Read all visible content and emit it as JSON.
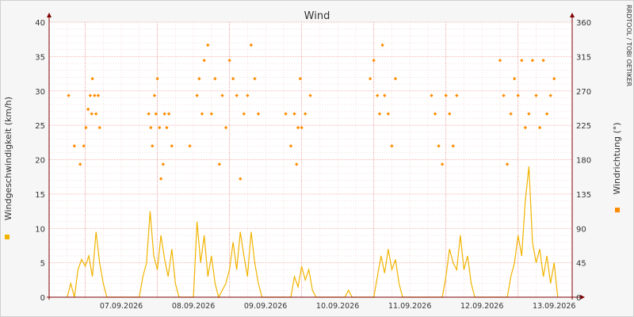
{
  "chart_data": {
    "type": "line",
    "title": "Wind",
    "watermark": "RRDTOOL / TOBI OETIKER",
    "x_dates": [
      "07.09.2026",
      "08.09.2026",
      "09.09.2026",
      "10.09.2026",
      "11.09.2026",
      "12.09.2026",
      "13.09.2026"
    ],
    "left_axis": {
      "label": "Windgeschwindigkeit (km/h)",
      "ticks": [
        0,
        5,
        10,
        15,
        20,
        25,
        30,
        35,
        40
      ],
      "ylim": [
        0,
        40
      ]
    },
    "right_axis": {
      "label": "Windrichtung (°)",
      "ticks": [
        0,
        45,
        90,
        135,
        180,
        225,
        270,
        315,
        360
      ],
      "ylim": [
        0,
        360
      ]
    },
    "colors": {
      "speed": "#f0b400",
      "direction": "#ff8c00",
      "grid_major": "#f0a0a0",
      "grid_minor": "#f2cccc",
      "axis": "#800000"
    },
    "series": [
      {
        "name": "Windgeschwindigkeit",
        "kind": "line",
        "axis": "left",
        "points": [
          [
            6.75,
            0
          ],
          [
            6.8,
            2
          ],
          [
            6.85,
            0
          ],
          [
            6.9,
            4
          ],
          [
            6.95,
            5.5
          ],
          [
            7.0,
            4.5
          ],
          [
            7.05,
            6
          ],
          [
            7.1,
            3
          ],
          [
            7.15,
            9.5
          ],
          [
            7.2,
            5
          ],
          [
            7.25,
            2
          ],
          [
            7.3,
            0
          ],
          [
            7.75,
            0
          ],
          [
            7.8,
            3
          ],
          [
            7.85,
            5
          ],
          [
            7.9,
            12.5
          ],
          [
            7.95,
            6
          ],
          [
            8.0,
            4
          ],
          [
            8.05,
            9
          ],
          [
            8.1,
            5.5
          ],
          [
            8.15,
            3
          ],
          [
            8.2,
            7
          ],
          [
            8.25,
            2
          ],
          [
            8.3,
            0
          ],
          [
            8.5,
            0
          ],
          [
            8.55,
            11
          ],
          [
            8.6,
            5
          ],
          [
            8.65,
            9
          ],
          [
            8.7,
            3
          ],
          [
            8.75,
            6
          ],
          [
            8.8,
            2
          ],
          [
            8.85,
            0
          ],
          [
            8.95,
            2
          ],
          [
            9.0,
            4
          ],
          [
            9.05,
            8
          ],
          [
            9.1,
            4
          ],
          [
            9.15,
            9.5
          ],
          [
            9.2,
            6
          ],
          [
            9.25,
            3
          ],
          [
            9.3,
            9.5
          ],
          [
            9.35,
            5
          ],
          [
            9.4,
            2
          ],
          [
            9.45,
            0
          ],
          [
            9.85,
            0
          ],
          [
            9.9,
            3
          ],
          [
            9.95,
            1.5
          ],
          [
            10.0,
            4.5
          ],
          [
            10.05,
            2.5
          ],
          [
            10.1,
            4
          ],
          [
            10.15,
            1
          ],
          [
            10.2,
            0
          ],
          [
            10.6,
            0
          ],
          [
            10.65,
            1
          ],
          [
            10.7,
            0
          ],
          [
            11.0,
            0
          ],
          [
            11.05,
            3
          ],
          [
            11.1,
            6
          ],
          [
            11.15,
            3.5
          ],
          [
            11.2,
            7
          ],
          [
            11.25,
            4
          ],
          [
            11.3,
            5.5
          ],
          [
            11.35,
            2
          ],
          [
            11.4,
            0
          ],
          [
            11.95,
            0
          ],
          [
            12.0,
            3
          ],
          [
            12.05,
            7
          ],
          [
            12.1,
            5
          ],
          [
            12.15,
            4
          ],
          [
            12.2,
            9
          ],
          [
            12.25,
            4
          ],
          [
            12.3,
            6
          ],
          [
            12.35,
            2
          ],
          [
            12.4,
            0
          ],
          [
            12.85,
            0
          ],
          [
            12.9,
            3
          ],
          [
            12.95,
            5
          ],
          [
            13.0,
            9
          ],
          [
            13.05,
            6
          ],
          [
            13.1,
            14
          ],
          [
            13.15,
            19
          ],
          [
            13.2,
            8
          ],
          [
            13.25,
            5
          ],
          [
            13.3,
            7
          ],
          [
            13.35,
            3
          ],
          [
            13.4,
            6
          ],
          [
            13.45,
            2
          ],
          [
            13.5,
            5
          ],
          [
            13.55,
            0
          ]
        ]
      },
      {
        "name": "Windrichtung",
        "kind": "points",
        "axis": "right",
        "points": [
          [
            6.77,
            264
          ],
          [
            6.85,
            198
          ],
          [
            6.93,
            174
          ],
          [
            6.98,
            198
          ],
          [
            7.01,
            222
          ],
          [
            7.04,
            246
          ],
          [
            7.07,
            264
          ],
          [
            7.09,
            240
          ],
          [
            7.1,
            286
          ],
          [
            7.13,
            264
          ],
          [
            7.15,
            240
          ],
          [
            7.18,
            264
          ],
          [
            7.2,
            222
          ],
          [
            7.88,
            240
          ],
          [
            7.91,
            222
          ],
          [
            7.93,
            198
          ],
          [
            7.96,
            264
          ],
          [
            7.98,
            240
          ],
          [
            8.0,
            286
          ],
          [
            8.03,
            222
          ],
          [
            8.05,
            155
          ],
          [
            8.08,
            174
          ],
          [
            8.1,
            240
          ],
          [
            8.13,
            222
          ],
          [
            8.16,
            240
          ],
          [
            8.2,
            198
          ],
          [
            8.45,
            198
          ],
          [
            8.55,
            264
          ],
          [
            8.58,
            286
          ],
          [
            8.62,
            240
          ],
          [
            8.65,
            310
          ],
          [
            8.7,
            330
          ],
          [
            8.75,
            240
          ],
          [
            8.8,
            286
          ],
          [
            8.86,
            174
          ],
          [
            8.9,
            264
          ],
          [
            8.95,
            222
          ],
          [
            9.0,
            310
          ],
          [
            9.05,
            286
          ],
          [
            9.1,
            264
          ],
          [
            9.15,
            155
          ],
          [
            9.2,
            240
          ],
          [
            9.25,
            264
          ],
          [
            9.3,
            330
          ],
          [
            9.35,
            286
          ],
          [
            9.4,
            240
          ],
          [
            9.78,
            240
          ],
          [
            9.85,
            198
          ],
          [
            9.9,
            240
          ],
          [
            9.93,
            174
          ],
          [
            9.95,
            222
          ],
          [
            9.98,
            286
          ],
          [
            10.0,
            222
          ],
          [
            10.05,
            240
          ],
          [
            10.12,
            264
          ],
          [
            10.95,
            286
          ],
          [
            11.0,
            310
          ],
          [
            11.05,
            264
          ],
          [
            11.08,
            240
          ],
          [
            11.12,
            330
          ],
          [
            11.15,
            264
          ],
          [
            11.2,
            240
          ],
          [
            11.25,
            198
          ],
          [
            11.3,
            286
          ],
          [
            11.8,
            264
          ],
          [
            11.85,
            240
          ],
          [
            11.9,
            198
          ],
          [
            11.95,
            174
          ],
          [
            12.0,
            264
          ],
          [
            12.05,
            240
          ],
          [
            12.1,
            198
          ],
          [
            12.15,
            264
          ],
          [
            12.75,
            310
          ],
          [
            12.8,
            264
          ],
          [
            12.85,
            174
          ],
          [
            12.9,
            240
          ],
          [
            12.95,
            286
          ],
          [
            13.0,
            264
          ],
          [
            13.05,
            310
          ],
          [
            13.1,
            222
          ],
          [
            13.15,
            240
          ],
          [
            13.2,
            310
          ],
          [
            13.25,
            264
          ],
          [
            13.3,
            222
          ],
          [
            13.35,
            310
          ],
          [
            13.4,
            240
          ],
          [
            13.45,
            264
          ],
          [
            13.5,
            286
          ]
        ]
      }
    ]
  }
}
